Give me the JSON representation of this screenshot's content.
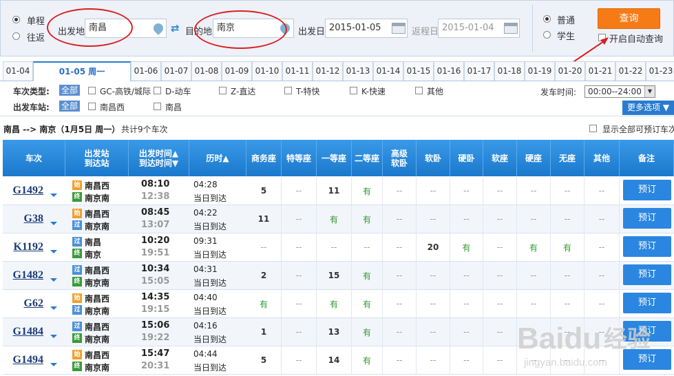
{
  "search": {
    "trip_oneway": "单程",
    "trip_round": "往返",
    "from_label": "出发地",
    "from_value": "南昌",
    "to_label": "目的地",
    "to_value": "南京",
    "depart_label": "出发日",
    "depart_value": "2015-01-05",
    "return_label": "返程日",
    "return_value": "2015-01-04",
    "type_normal": "普通",
    "type_student": "学生",
    "query_button": "查询",
    "auto_query": "开启自动查询"
  },
  "date_tabs": [
    "01-04",
    "01-05 周一",
    "01-06",
    "01-07",
    "01-08",
    "01-09",
    "01-10",
    "01-11",
    "01-12",
    "01-13",
    "01-14",
    "01-15",
    "01-16",
    "01-17",
    "01-18",
    "01-19",
    "01-20",
    "01-21",
    "01-22",
    "01-23"
  ],
  "active_tab_index": 1,
  "filter": {
    "type_label": "车次类型:",
    "all": "全部",
    "types": [
      "GC-高铁/城际",
      "D-动车",
      "Z-直达",
      "T-特快",
      "K-快速",
      "其他"
    ],
    "station_label": "出发车站:",
    "stations": [
      "南昌西",
      "南昌"
    ],
    "time_label": "发车时间:",
    "time_value": "00:00--24:00",
    "more_options": "更多选项"
  },
  "summary": {
    "route": "南昌 --> 南京（1月5日  周一）",
    "count_text": "共计9个车次",
    "show_all": "显示全部可预订车次"
  },
  "columns": [
    "车次",
    "出发站\n到达站",
    "出发时间▲\n到达时间▼",
    "历时▲",
    "商务座",
    "特等座",
    "一等座",
    "二等座",
    "高级\n软卧",
    "软卧",
    "硬卧",
    "软座",
    "硬座",
    "无座",
    "其他",
    "备注"
  ],
  "trains": [
    {
      "no": "G1492",
      "from": "南昌西",
      "to": "南京南",
      "from_type": "start",
      "to_type": "end",
      "dep": "08:10",
      "arr": "12:38",
      "dur": "04:28",
      "arrive": "当日到达",
      "seats": [
        "5",
        "--",
        "11",
        "有",
        "--",
        "--",
        "--",
        "--",
        "--",
        "--",
        "--"
      ]
    },
    {
      "no": "G38",
      "from": "南昌西",
      "to": "南京南",
      "from_type": "start",
      "to_type": "pass",
      "dep": "08:45",
      "arr": "13:07",
      "dur": "04:22",
      "arrive": "当日到达",
      "seats": [
        "11",
        "--",
        "有",
        "有",
        "--",
        "--",
        "--",
        "--",
        "--",
        "--",
        "--"
      ]
    },
    {
      "no": "K1192",
      "from": "南昌",
      "to": "南京",
      "from_type": "pass",
      "to_type": "end",
      "dep": "10:20",
      "arr": "19:51",
      "dur": "09:31",
      "arrive": "当日到达",
      "seats": [
        "--",
        "--",
        "--",
        "--",
        "--",
        "20",
        "有",
        "--",
        "有",
        "有",
        "--"
      ]
    },
    {
      "no": "G1482",
      "from": "南昌西",
      "to": "南京南",
      "from_type": "pass",
      "to_type": "end",
      "dep": "10:34",
      "arr": "15:05",
      "dur": "04:31",
      "arrive": "当日到达",
      "seats": [
        "2",
        "--",
        "15",
        "有",
        "--",
        "--",
        "--",
        "--",
        "--",
        "--",
        "--"
      ]
    },
    {
      "no": "G62",
      "from": "南昌西",
      "to": "南京南",
      "from_type": "start",
      "to_type": "pass",
      "dep": "14:35",
      "arr": "19:15",
      "dur": "04:40",
      "arrive": "当日到达",
      "seats": [
        "有",
        "--",
        "有",
        "有",
        "--",
        "--",
        "--",
        "--",
        "--",
        "--",
        "--"
      ]
    },
    {
      "no": "G1484",
      "from": "南昌西",
      "to": "南京南",
      "from_type": "pass",
      "to_type": "end",
      "dep": "15:06",
      "arr": "19:22",
      "dur": "04:16",
      "arrive": "当日到达",
      "seats": [
        "1",
        "--",
        "13",
        "有",
        "--",
        "--",
        "--",
        "--",
        "--",
        "--",
        "--"
      ]
    },
    {
      "no": "G1494",
      "from": "南昌西",
      "to": "南京南",
      "from_type": "start",
      "to_type": "end",
      "dep": "15:47",
      "arr": "20:31",
      "dur": "04:44",
      "arrive": "当日到达",
      "seats": [
        "5",
        "--",
        "14",
        "有",
        "--",
        "--",
        "--",
        "--",
        "--",
        "--",
        "--"
      ]
    }
  ],
  "book_label": "预订",
  "station_icons": {
    "start": "始",
    "pass": "过",
    "end": "终"
  },
  "watermark": {
    "brand": "Baidu",
    "brand_cn": "经验",
    "url": "jingyan.baidu.com"
  }
}
